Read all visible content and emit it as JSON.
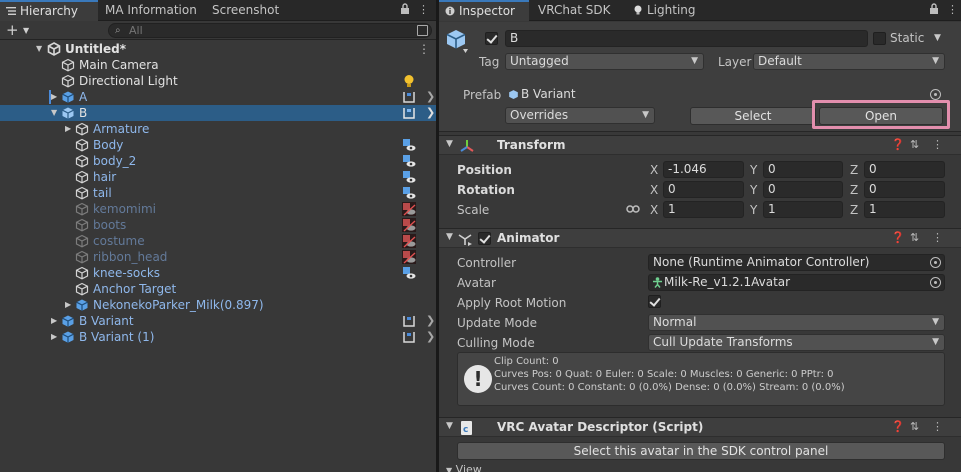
{
  "hierarchy": {
    "tabs": [
      {
        "label": "Hierarchy",
        "icon": "list-icon"
      },
      {
        "label": "MA Information"
      },
      {
        "label": "Screenshot"
      }
    ],
    "search_placeholder": "All",
    "scene_name": "Untitled*",
    "items": [
      {
        "label": "Main Camera",
        "style": "white"
      },
      {
        "label": "Directional Light",
        "style": "white"
      },
      {
        "label": "A",
        "style": "blue"
      },
      {
        "label": "B",
        "style": "white"
      },
      {
        "label": "Armature",
        "style": "blue"
      },
      {
        "label": "Body",
        "style": "blue"
      },
      {
        "label": "body_2",
        "style": "blue"
      },
      {
        "label": "hair",
        "style": "blue"
      },
      {
        "label": "tail",
        "style": "blue"
      },
      {
        "label": "kemomimi",
        "style": "dim"
      },
      {
        "label": "boots",
        "style": "dim"
      },
      {
        "label": "costume",
        "style": "dim"
      },
      {
        "label": "ribbon_head",
        "style": "dim"
      },
      {
        "label": "knee-socks",
        "style": "blue"
      },
      {
        "label": "Anchor Target",
        "style": "blue"
      },
      {
        "label": "NekonekoParker_Milk(0.897)",
        "style": "blue"
      },
      {
        "label": "B Variant",
        "style": "blue"
      },
      {
        "label": "B Variant (1)",
        "style": "blue"
      }
    ]
  },
  "inspector": {
    "tabs": [
      {
        "label": "Inspector",
        "icon": "info-icon"
      },
      {
        "label": "VRChat SDK"
      },
      {
        "label": "Lighting",
        "icon": "lightbulb-icon"
      }
    ],
    "object_name": "B",
    "static_label": "Static",
    "tag_label": "Tag",
    "tag_value": "Untagged",
    "layer_label": "Layer",
    "layer_value": "Default",
    "prefab_label": "Prefab",
    "prefab_value": "B Variant",
    "overrides_label": "Overrides",
    "select_label": "Select",
    "open_label": "Open",
    "highlight_color": "#e38fae",
    "transform": {
      "title": "Transform",
      "position_label": "Position",
      "rotation_label": "Rotation",
      "scale_label": "Scale",
      "position": {
        "x": "-1.046",
        "y": "0",
        "z": "0"
      },
      "rotation": {
        "x": "0",
        "y": "0",
        "z": "0"
      },
      "scale": {
        "x": "1",
        "y": "1",
        "z": "1"
      }
    },
    "animator": {
      "title": "Animator",
      "controller_label": "Controller",
      "controller_value": "None (Runtime Animator Controller)",
      "avatar_label": "Avatar",
      "avatar_value": "Milk-Re_v1.2.1Avatar",
      "apply_root_motion_label": "Apply Root Motion",
      "update_mode_label": "Update Mode",
      "update_mode_value": "Normal",
      "culling_mode_label": "Culling Mode",
      "culling_mode_value": "Cull Update Transforms",
      "info_lines": [
        "Clip Count: 0",
        "Curves Pos: 0 Quat: 0 Euler: 0 Scale: 0 Muscles: 0 Generic: 0 PPtr: 0",
        "Curves Count: 0 Constant: 0 (0.0%) Dense: 0 (0.0%) Stream: 0 (0.0%)"
      ]
    },
    "vrc": {
      "title": "VRC Avatar Descriptor (Script)",
      "button_label": "Select this avatar in the SDK control panel",
      "next_label": "View"
    }
  }
}
